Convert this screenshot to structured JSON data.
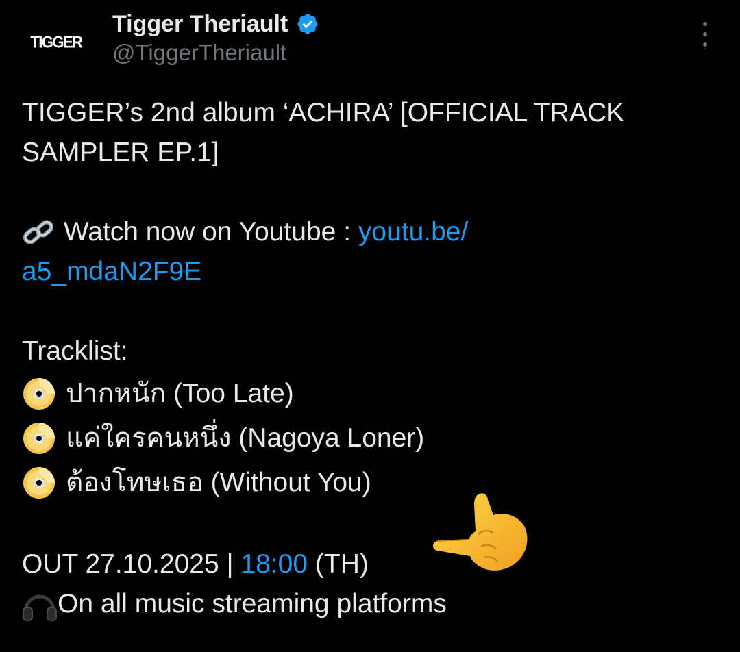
{
  "author": {
    "avatar_text": "TIGGER",
    "display_name": "Tigger Theriault",
    "handle": "@TiggerTheriault",
    "verified": true,
    "verified_color": "#1d9bf0"
  },
  "more_icon": "more-dots-vertical-icon",
  "tweet": {
    "title_line1": "TIGGER’s 2nd album ‘ACHIRA’ [OFFICIAL TRACK",
    "title_line2": "SAMPLER EP.1]",
    "watch_icon": "link-emoji",
    "watch_text": " Watch now on Youtube : ",
    "watch_link_part1": "youtu.be/",
    "watch_link_part2": "a5_mdaN2F9E",
    "tracklist_label": "Tracklist:",
    "track_icon": "dvd-emoji",
    "tracks": [
      "ปากหนัก (Too Late)",
      "แค่ใครคนหนึ่ง (Nagoya Loner)",
      "ต้องโทษเธอ (Without You)"
    ],
    "release_prefix": "OUT 27.10.2025 | ",
    "release_time": "18:00",
    "release_suffix": " (TH)",
    "streaming_icon": "headphones-emoji",
    "streaming_text": "On all music streaming platforms",
    "decoration_icon": "pointing-hand-emoji"
  },
  "colors": {
    "background": "#000000",
    "text": "#e7e9ea",
    "secondary": "#71767b",
    "link": "#1d9bf0"
  }
}
